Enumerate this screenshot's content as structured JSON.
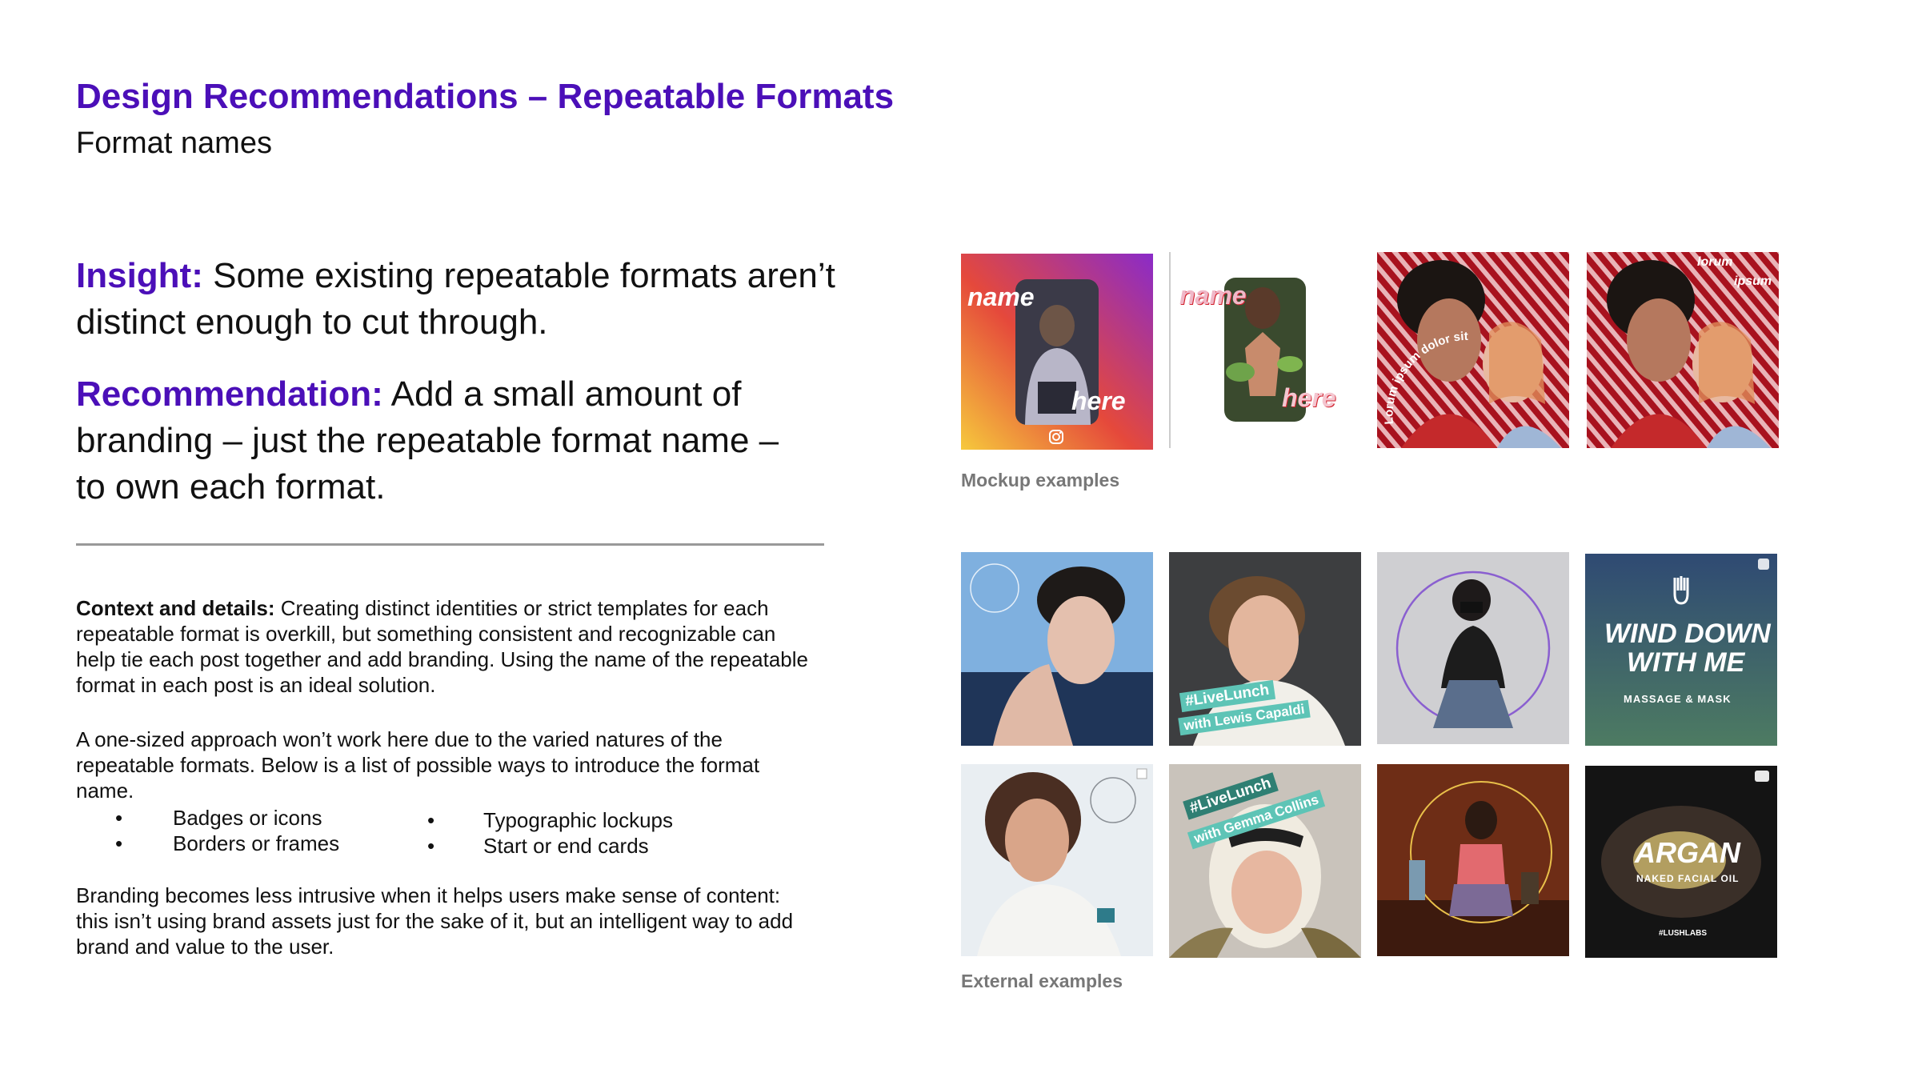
{
  "header": {
    "title": "Design Recommendations – Repeatable Formats",
    "subtitle": "Format names"
  },
  "insight": {
    "label": "Insight:",
    "line1": "Some existing repeatable formats aren’t",
    "line2": "distinct enough to cut through."
  },
  "recommendation": {
    "label": "Recommendation:",
    "line1": "Add a small amount of",
    "line2": "branding – just the repeatable format name –",
    "line3": "to own each format."
  },
  "context": {
    "label": "Context and details:",
    "p1_line1": "Creating distinct identities or strict templates for each",
    "p1_line2": "repeatable format is overkill, but something consistent and recognizable can",
    "p1_line3": "help tie each post together and add branding. Using the name of the repeatable",
    "p1_line4": "format in each post is an ideal solution.",
    "p2_line1": "A one-sized approach won’t work here due to the varied natures of the",
    "p2_line2": "repeatable formats. Below is a list of possible ways to introduce the format",
    "p2_line3": "name.",
    "bullets_left": [
      "Badges or icons",
      "Borders or frames"
    ],
    "bullets_right": [
      "Typographic lockups",
      "Start or end cards"
    ],
    "bullet_symbol": "•",
    "p3_line1": "Branding becomes less intrusive when it helps users make sense of content:",
    "p3_line2": "this isn’t using brand assets just for the sake of it, but an intelligent way to add",
    "p3_line3": "brand and value to the user."
  },
  "mockups": {
    "caption": "Mockup examples",
    "tile1": {
      "top": "name",
      "bottom": "here"
    },
    "tile2": {
      "top": "name",
      "bottom": "here"
    },
    "tile3": {
      "arc": "Lorum ipsum dolor sit amet"
    },
    "tile4": {
      "top": "lorum",
      "bottom": "ipsum"
    }
  },
  "external": {
    "caption": "External examples",
    "tile_live1": {
      "tag1": "#LiveLunch",
      "tag2": "with Lewis Capaldi"
    },
    "tile_live2": {
      "tag1": "#LiveLunch",
      "tag2": "with Gemma Collins"
    },
    "tile_wind": {
      "line1": "WIND DOWN",
      "line2": "WITH ME",
      "sub": "MASSAGE & MASK"
    },
    "tile_argan": {
      "title": "ARGAN",
      "sub": "NAKED FACIAL OIL",
      "tag": "#LUSHLABS"
    }
  },
  "colors": {
    "accent": "#4b0fb8",
    "caption_gray": "#777777",
    "rule_gray": "#999999",
    "live_teal": "#5ec4b6"
  }
}
